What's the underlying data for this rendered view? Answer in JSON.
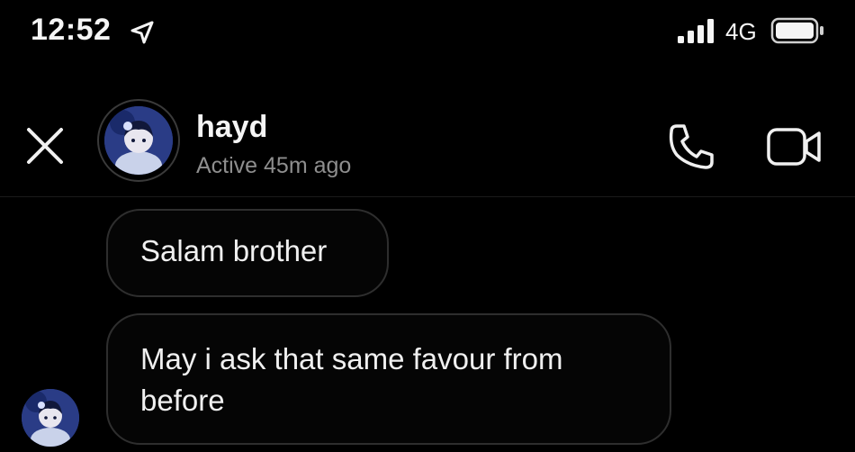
{
  "status_bar": {
    "time": "12:52",
    "network": "4G",
    "icons": [
      "location-arrow-icon",
      "signal-bars-icon",
      "battery-icon"
    ]
  },
  "header": {
    "contact_name": "hayd",
    "active_status": "Active 45m ago",
    "icons": [
      "close-icon",
      "avatar",
      "phone-icon",
      "video-camera-icon"
    ]
  },
  "messages": [
    {
      "text": "Salam brother"
    },
    {
      "text": "May i ask that same favour from before"
    }
  ],
  "colors": {
    "background": "#000000",
    "text": "#f0f0f0",
    "secondary_text": "#8e8e8e",
    "bubble_border": "#2e2e2e",
    "avatar_bg": "#2a3c86"
  }
}
